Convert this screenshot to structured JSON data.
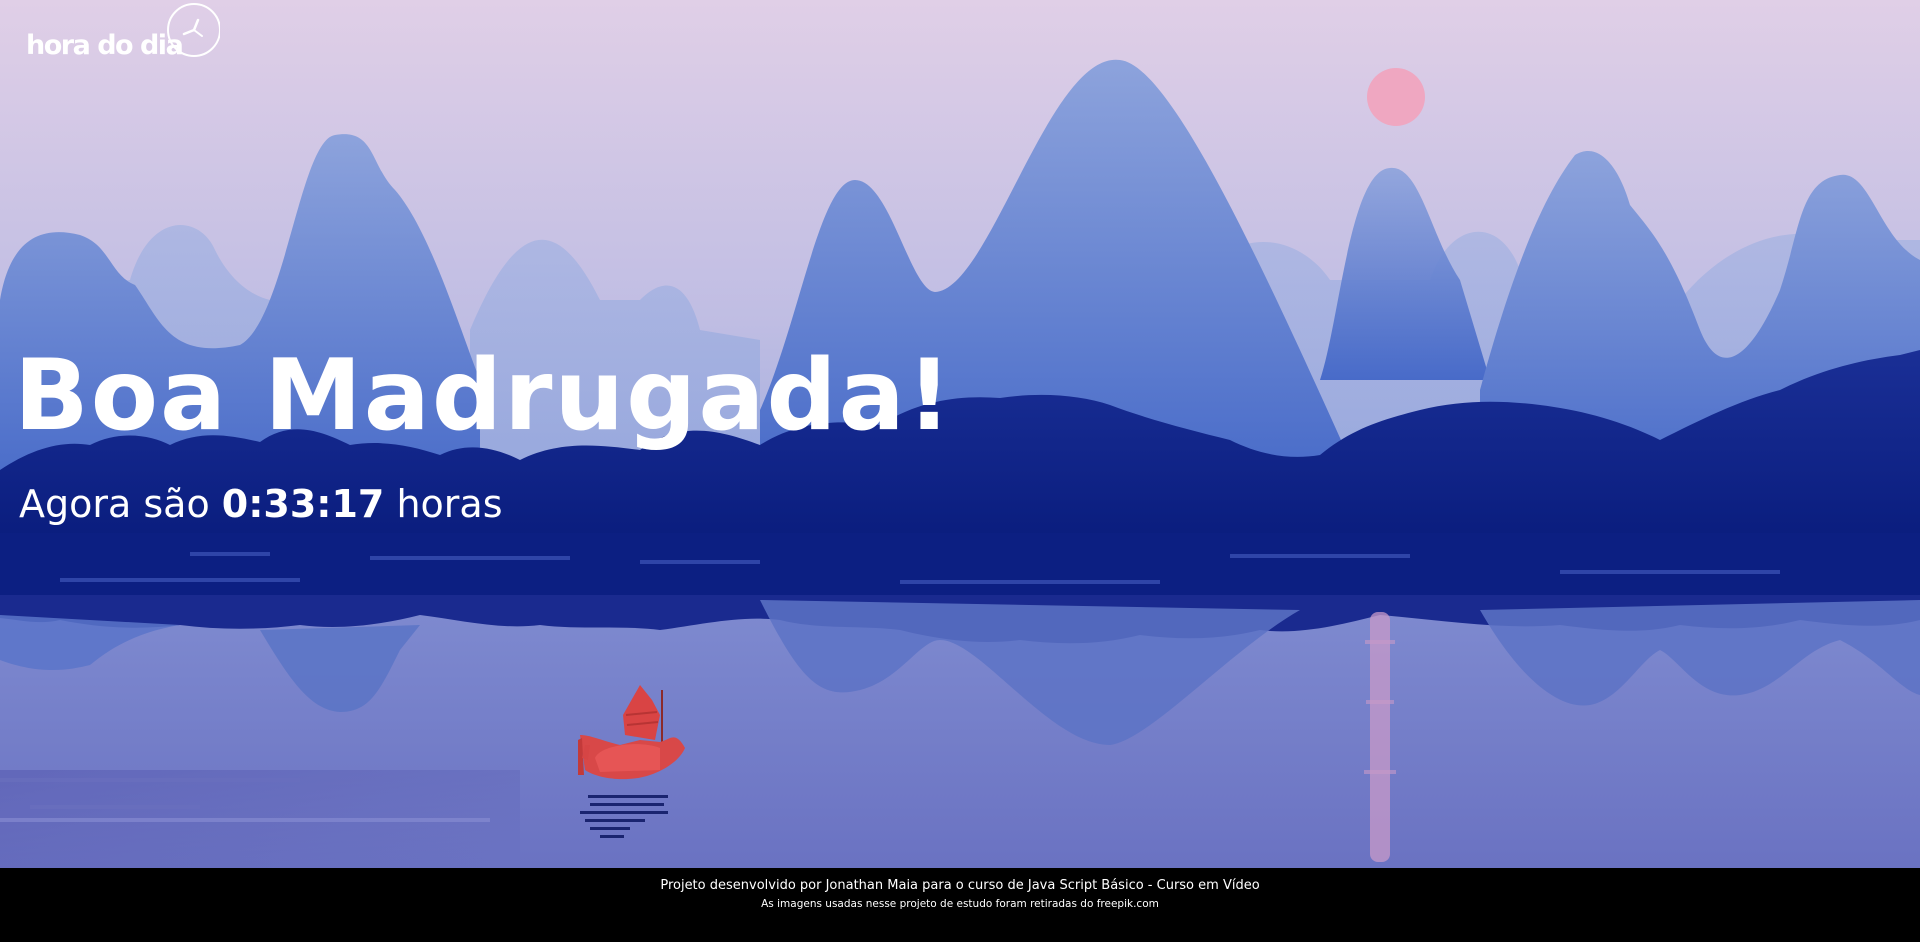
{
  "logo": {
    "text": "hora do dia",
    "icon": "clock-icon"
  },
  "greeting": "Boa Madrugada!",
  "time_prefix": "Agora são ",
  "time_value": "0:33:17",
  "time_suffix": " horas",
  "footer": {
    "credit": "Projeto desenvolvido por Jonathan Maia para o curso de Java Script Básico - Curso em Vídeo",
    "source": "As imagens usadas nesse projeto de estudo foram retiradas do freepik.com"
  },
  "colors": {
    "sky_top": "#dfcde6",
    "mountain": "#6e8fd4",
    "forest": "#0e2483",
    "water": "#7d86ce",
    "boat": "#d64545",
    "sun": "#f0a8c0"
  }
}
